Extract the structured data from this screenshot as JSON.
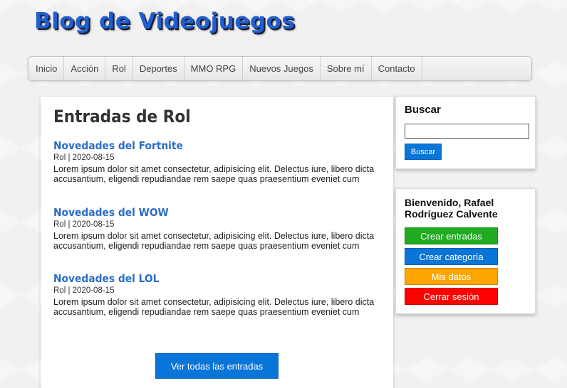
{
  "site": {
    "title": "Blog de Videojuegos"
  },
  "nav": {
    "items": [
      "Inicio",
      "Acción",
      "Rol",
      "Deportes",
      "MMO RPG",
      "Nuevos Juegos",
      "Sobre mí",
      "Contacto"
    ]
  },
  "main": {
    "title": "Entradas de Rol",
    "entries": [
      {
        "title": "Novedades del Fortnite",
        "meta": "Rol | 2020-08-15",
        "text": "Lorem ipsum dolor sit amet consectetur, adipisicing elit. Delectus iure, libero dicta accusantium, eligendi repudiandae rem saepe quas praesentium eveniet cum"
      },
      {
        "title": "Novedades del WOW",
        "meta": "Rol | 2020-08-15",
        "text": "Lorem ipsum dolor sit amet consectetur, adipisicing elit. Delectus iure, libero dicta accusantium, eligendi repudiandae rem saepe quas praesentium eveniet cum"
      },
      {
        "title": "Novedades del LOL",
        "meta": "Rol | 2020-08-15",
        "text": "Lorem ipsum dolor sit amet consectetur, adipisicing elit. Delectus iure, libero dicta accusantium, eligendi repudiandae rem saepe quas praesentium eveniet cum"
      }
    ],
    "view_all_label": "Ver todas las entradas"
  },
  "search": {
    "title": "Buscar",
    "value": "",
    "button_label": "Buscar"
  },
  "user": {
    "welcome": "Bienvenido, Rafael Rodríguez Calvente",
    "actions": [
      {
        "label": "Crear entradas",
        "color": "#1faa1f",
        "text_color": "#ffffff"
      },
      {
        "label": "Crear categoría",
        "color": "#0a75d8",
        "text_color": "#ffffff"
      },
      {
        "label": "Mis datos",
        "color": "#ffa500",
        "text_color": "#ffffff"
      },
      {
        "label": "Cerrar sesión",
        "color": "#ff0000",
        "text_color": "#ffffff"
      }
    ]
  },
  "colors": {
    "accent_blue": "#0a75d8",
    "title_blue": "#1f5fd0",
    "link_blue": "#2a6cc6"
  }
}
